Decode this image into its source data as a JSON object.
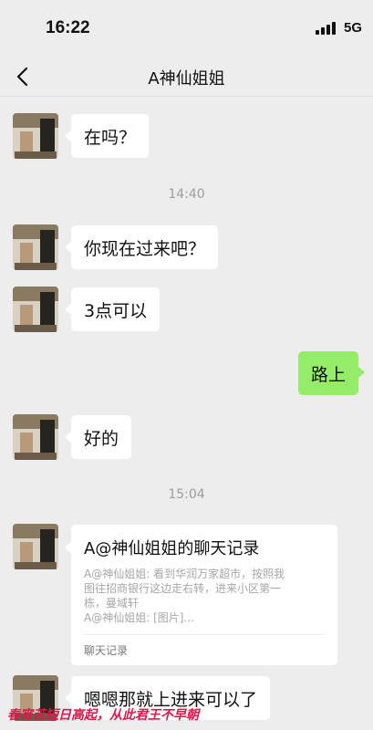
{
  "status_bar": {
    "time": "16:22",
    "network": "5G"
  },
  "nav": {
    "title": "A神仙姐姐"
  },
  "messages": [
    {
      "text": "在吗？"
    },
    {
      "timestamp": "14:40"
    },
    {
      "text": "你现在过来吧？"
    },
    {
      "text": "3点可以"
    },
    {
      "text": "路上"
    },
    {
      "text": "好的"
    },
    {
      "timestamp": "15:04"
    },
    {
      "text": "嗯嗯那就上进来可以了"
    }
  ],
  "chat_record": {
    "title": "A@神仙姐姐的聊天记录",
    "lines": [
      "A@神仙姐姐: 看到华润万家超市，按照我",
      "图往招商银行这边走右转，进来小区第一",
      "栋，曼域轩",
      "A@神仙姐姐: [图片]..."
    ],
    "footer": "聊天记录"
  },
  "watermark": "春宵苦短日高起，从此君王不早朝",
  "colors": {
    "background": "#ededed",
    "incoming_bubble": "#ffffff",
    "outgoing_bubble": "#95ec69",
    "watermark": "#e0164a"
  }
}
